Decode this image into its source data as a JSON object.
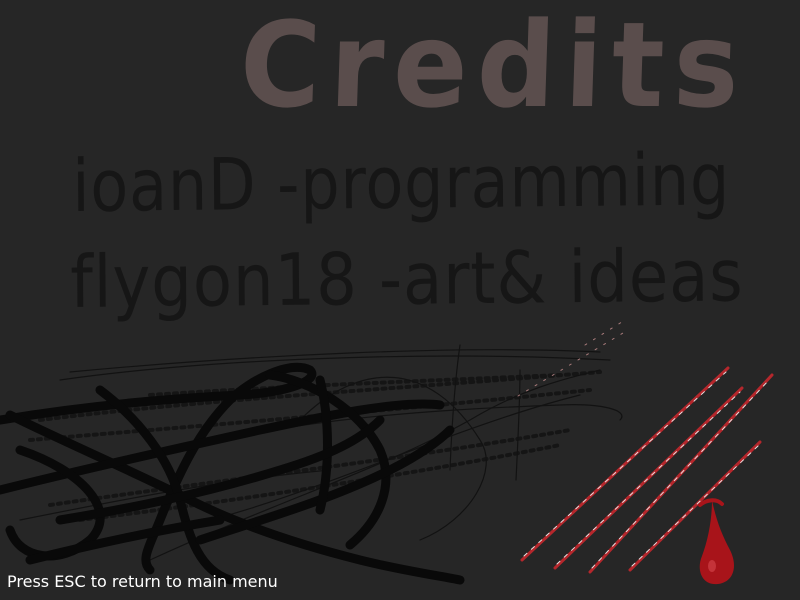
{
  "title": "Credits",
  "credits": [
    {
      "text": "ioanD -programming"
    },
    {
      "text": "flygon18 -art& ideas"
    }
  ],
  "escape_hint": "Press ESC to return to main menu",
  "colors": {
    "background": "#262626",
    "title": "#5a4d4c",
    "credit_text": "#161616",
    "scribble": "#0b0b0b",
    "scratch_red": "#b5272c",
    "scratch_white": "#e8e0e0",
    "blood": "#a8141a",
    "hint_text": "#ffffff"
  },
  "decorations": [
    "black-scribble",
    "red-claw-scratches",
    "blood-drop"
  ]
}
